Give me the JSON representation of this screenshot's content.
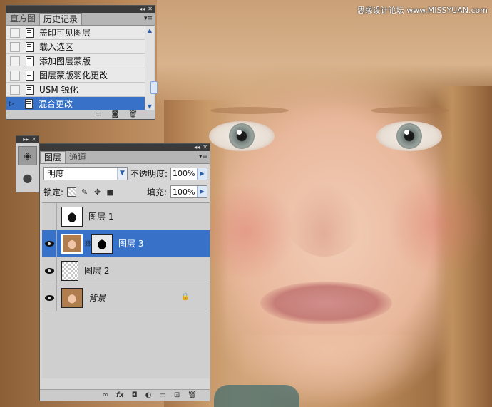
{
  "watermark": "思缘设计论坛 www.MISSYUAN.com",
  "history_panel": {
    "collapse_glyph": "◂◂",
    "close_glyph": "✕",
    "tabs": [
      "直方图",
      "历史记录"
    ],
    "active_tab": 1,
    "menu_glyph": "▾≡",
    "items": [
      {
        "label": "盖印可见图层",
        "selected": false
      },
      {
        "label": "载入选区",
        "selected": false
      },
      {
        "label": "添加图层蒙版",
        "selected": false
      },
      {
        "label": "图层蒙版羽化更改",
        "selected": false
      },
      {
        "label": "USM 锐化",
        "selected": false
      },
      {
        "label": "混合更改",
        "selected": true
      }
    ],
    "scroll_up": "▲",
    "scroll_down": "▼",
    "footer_icons": [
      "new-document-from-state-icon",
      "camera-snapshot-icon",
      "trash-icon"
    ]
  },
  "tool_strip": {
    "collapse_glyph": "▸▸",
    "close_glyph": "✕",
    "buttons": [
      "layers-panel-icon",
      "channels-panel-icon"
    ]
  },
  "layers_panel": {
    "collapse_glyph": "◂◂",
    "close_glyph": "✕",
    "tabs": [
      "图层",
      "通道"
    ],
    "active_tab": 0,
    "menu_glyph": "▾≡",
    "blend_mode": "明度",
    "opacity_label": "不透明度:",
    "opacity_value": "100%",
    "lock_label": "锁定:",
    "fill_label": "填充:",
    "fill_value": "100%",
    "layers": [
      {
        "name": "图层 1",
        "visible": false,
        "selected": false,
        "thumb": "mask"
      },
      {
        "name": "图层 3",
        "visible": true,
        "selected": true,
        "thumb": "face-with-mask"
      },
      {
        "name": "图层 2",
        "visible": true,
        "selected": false,
        "thumb": "transparent"
      },
      {
        "name": "背景",
        "visible": true,
        "selected": false,
        "thumb": "face",
        "locked": true
      }
    ],
    "footer_icons": [
      "link-layers-icon",
      "fx-icon",
      "add-mask-icon",
      "adjustment-layer-icon",
      "new-group-icon",
      "new-layer-icon",
      "trash-icon"
    ]
  }
}
